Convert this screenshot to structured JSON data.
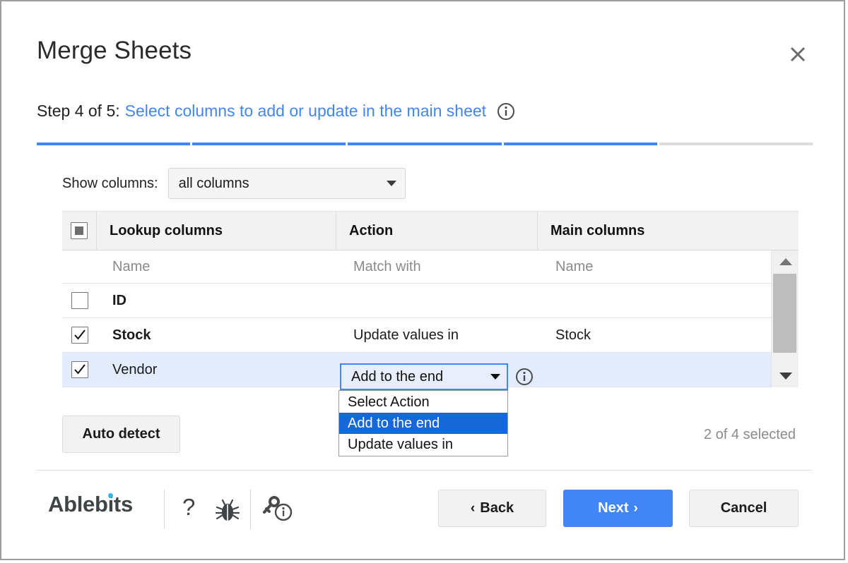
{
  "dialog": {
    "title": "Merge Sheets",
    "close_label": "close-icon"
  },
  "step": {
    "prefix": "Step 4 of 5:",
    "link": "Select columns to add or update in the main sheet",
    "total_segments": 5,
    "completed_segments": 4,
    "accent_color": "#4285f4",
    "inactive_color": "#dcdcdc"
  },
  "filter": {
    "label": "Show columns:",
    "value": "all columns",
    "options": [
      "all columns"
    ]
  },
  "table": {
    "headers": {
      "lookup": "Lookup columns",
      "action": "Action",
      "main": "Main columns"
    },
    "subheaders": {
      "lookup": "Name",
      "action": "Match with",
      "main": "Name"
    },
    "rows": [
      {
        "checked": false,
        "name": "ID",
        "bold": true,
        "action": "",
        "main": "",
        "selected": false
      },
      {
        "checked": true,
        "name": "Stock",
        "bold": true,
        "action": "Update values in",
        "main": "Stock",
        "selected": false
      },
      {
        "checked": true,
        "name": "Vendor",
        "bold": false,
        "action": "",
        "main": "",
        "selected": true
      }
    ]
  },
  "action_dropdown": {
    "value": "Add to the end",
    "options": [
      "Select Action",
      "Add to the end",
      "Update values in"
    ],
    "selected_index": 1,
    "highlight_color": "#1667d8"
  },
  "controls": {
    "auto_detect": "Auto detect",
    "selected_count": "2 of 4 selected"
  },
  "footer": {
    "brand": "Ablebits",
    "brand_dot_color": "#34b3e8",
    "help_icon": "?",
    "bug_icon": "bug-icon",
    "key_info_icon": "key-info-icon",
    "back": "Back",
    "back_chevron": "‹",
    "next": "Next",
    "next_chevron": "›",
    "cancel": "Cancel"
  }
}
